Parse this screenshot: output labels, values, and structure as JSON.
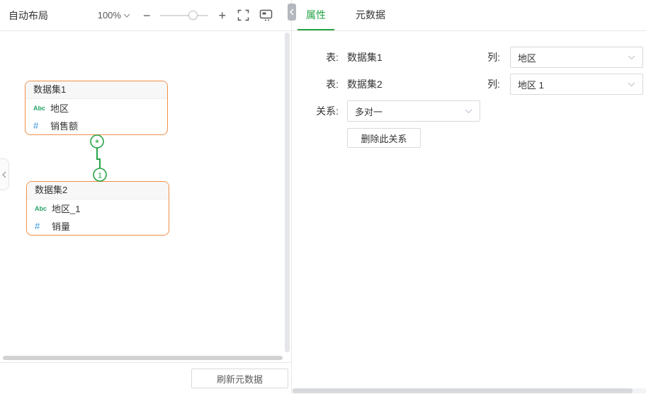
{
  "toolbar": {
    "auto_layout_label": "自动布局",
    "zoom_value": "100%",
    "zoom_out_label": "−",
    "zoom_in_label": "+"
  },
  "canvas": {
    "cards": [
      {
        "title": "数据集1",
        "fields": [
          {
            "type_icon": "Abc",
            "name": "地区"
          },
          {
            "type_icon": "#",
            "name": "销售额"
          }
        ]
      },
      {
        "title": "数据集2",
        "fields": [
          {
            "type_icon": "Abc",
            "name": "地区_1"
          },
          {
            "type_icon": "#",
            "name": "销量"
          }
        ]
      }
    ],
    "relation_markers": {
      "many": "*",
      "one": "1"
    }
  },
  "left_footer": {
    "refresh_button_label": "刷新元数据"
  },
  "right_panel": {
    "tabs": [
      {
        "label": "属性"
      },
      {
        "label": "元数据"
      }
    ],
    "mapping_rows": [
      {
        "table_label": "表:",
        "table_value": "数据集1",
        "column_label": "列:",
        "column_value": "地区"
      },
      {
        "table_label": "表:",
        "table_value": "数据集2",
        "column_label": "列:",
        "column_value": "地区 1"
      }
    ],
    "relation_row": {
      "label": "关系:",
      "value": "多对一"
    },
    "delete_button_label": "删除此关系"
  },
  "colors": {
    "accent_green": "#27a447",
    "card_border_orange": "#ef8f49",
    "string_type_green": "#27a567",
    "number_type_blue": "#3295dc"
  }
}
